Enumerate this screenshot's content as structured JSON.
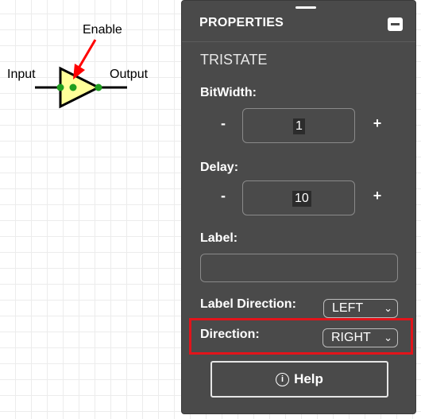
{
  "canvas": {
    "labels": {
      "enable": "Enable",
      "input": "Input",
      "output": "Output"
    },
    "colors": {
      "tristate_fill": "#ffff99",
      "pin": "#1f9e1f",
      "arrow": "#ff0000"
    }
  },
  "panel": {
    "title": "PROPERTIES",
    "element_name": "TRISTATE",
    "bitwidth": {
      "label": "BitWidth:",
      "minus": "-",
      "value": "1",
      "plus": "+"
    },
    "delay": {
      "label": "Delay:",
      "minus": "-",
      "value": "10",
      "plus": "+"
    },
    "label_field": {
      "label": "Label:",
      "value": ""
    },
    "label_direction": {
      "label": "Label Direction:",
      "selected": "LEFT"
    },
    "direction": {
      "label": "Direction:",
      "selected": "RIGHT"
    },
    "help": {
      "icon": "i",
      "label": "Help"
    },
    "colors": {
      "background": "#4a4a4a",
      "highlight": "#e2141b"
    }
  }
}
